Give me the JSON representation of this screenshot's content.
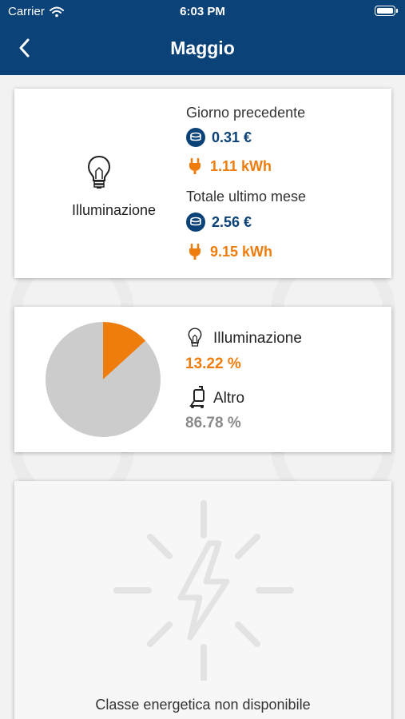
{
  "status_bar": {
    "carrier": "Carrier",
    "time": "6:03 PM"
  },
  "header": {
    "title": "Maggio"
  },
  "consumption_card": {
    "category": "Illuminazione",
    "previous_day": {
      "label": "Giorno precedente",
      "cost": "0.31 €",
      "energy": "1.11 kWh"
    },
    "last_month": {
      "label": "Totale ultimo mese",
      "cost": "2.56 €",
      "energy": "9.15 kWh"
    }
  },
  "chart_data": {
    "type": "pie",
    "slices": [
      {
        "label": "Illuminazione",
        "value": 13.22,
        "value_text": "13.22 %",
        "color": "#ef7d0e"
      },
      {
        "label": "Altro",
        "value": 86.78,
        "value_text": "86.78 %",
        "color": "#cccccc"
      }
    ]
  },
  "energy_class_card": {
    "message": "Classe energetica non disponibile"
  },
  "colors": {
    "primary": "#0b4278",
    "accent": "#ef7d0e",
    "muted": "#8a8a8a"
  }
}
